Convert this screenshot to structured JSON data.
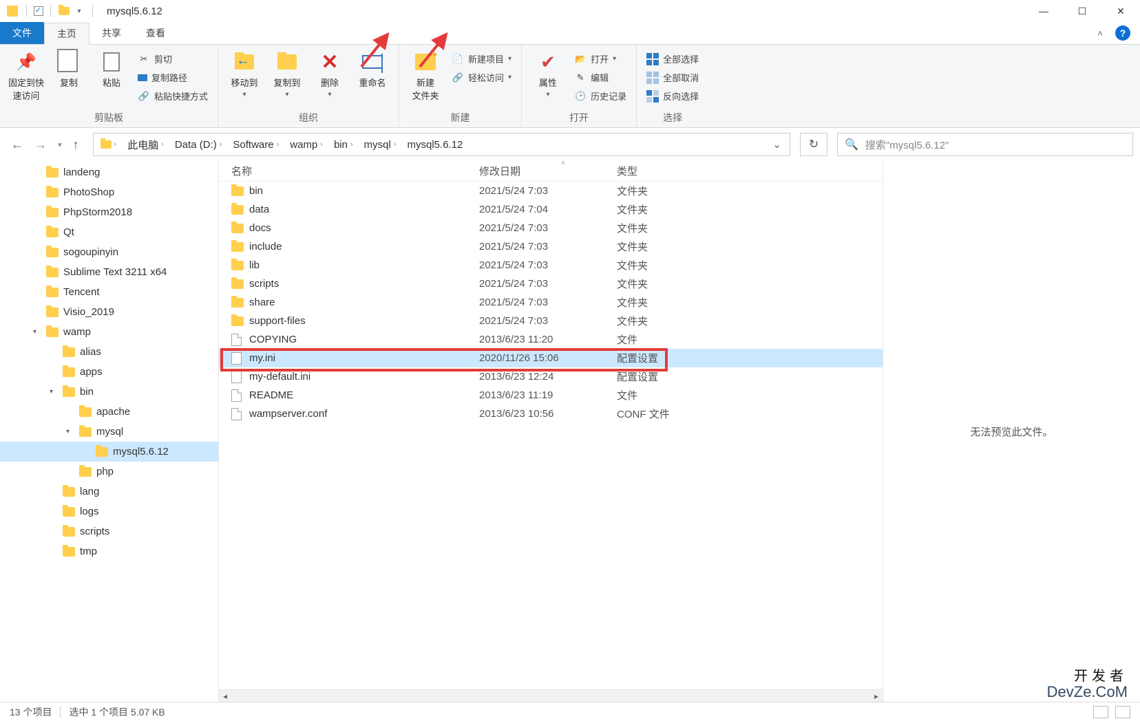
{
  "title": "mysql5.6.12",
  "tabs": {
    "file": "文件",
    "home": "主页",
    "share": "共享",
    "view": "查看"
  },
  "ribbon": {
    "clipboard": {
      "pin": "固定到快\n速访问",
      "copy": "复制",
      "paste": "粘贴",
      "cut": "剪切",
      "copypath": "复制路径",
      "paste_shortcut": "粘贴快捷方式",
      "label": "剪贴板"
    },
    "organize": {
      "move_to": "移动到",
      "copy_to": "复制到",
      "delete": "删除",
      "rename": "重命名",
      "label": "组织"
    },
    "new": {
      "new_folder": "新建\n文件夹",
      "new_item": "新建项目",
      "easy_access": "轻松访问",
      "label": "新建"
    },
    "open": {
      "properties": "属性",
      "open": "打开",
      "edit": "编辑",
      "history": "历史记录",
      "label": "打开"
    },
    "select": {
      "select_all": "全部选择",
      "select_none": "全部取消",
      "invert": "反向选择",
      "label": "选择"
    }
  },
  "breadcrumb": [
    "此电脑",
    "Data (D:)",
    "Software",
    "wamp",
    "bin",
    "mysql",
    "mysql5.6.12"
  ],
  "search_placeholder": "搜索\"mysql5.6.12\"",
  "sidebar": [
    {
      "name": "landeng",
      "depth": 1,
      "exp": ""
    },
    {
      "name": "PhotoShop",
      "depth": 1,
      "exp": ""
    },
    {
      "name": "PhpStorm2018",
      "depth": 1,
      "exp": ""
    },
    {
      "name": "Qt",
      "depth": 1,
      "exp": ""
    },
    {
      "name": "sogoupinyin",
      "depth": 1,
      "exp": ""
    },
    {
      "name": "Sublime Text 3211 x64",
      "depth": 1,
      "exp": ""
    },
    {
      "name": "Tencent",
      "depth": 1,
      "exp": ""
    },
    {
      "name": "Visio_2019",
      "depth": 1,
      "exp": ""
    },
    {
      "name": "wamp",
      "depth": 1,
      "exp": "▾"
    },
    {
      "name": "alias",
      "depth": 2,
      "exp": ""
    },
    {
      "name": "apps",
      "depth": 2,
      "exp": ""
    },
    {
      "name": "bin",
      "depth": 2,
      "exp": "▾"
    },
    {
      "name": "apache",
      "depth": 3,
      "exp": ""
    },
    {
      "name": "mysql",
      "depth": 3,
      "exp": "▾"
    },
    {
      "name": "mysql5.6.12",
      "depth": 4,
      "exp": "",
      "selected": true
    },
    {
      "name": "php",
      "depth": 3,
      "exp": ""
    },
    {
      "name": "lang",
      "depth": 2,
      "exp": ""
    },
    {
      "name": "logs",
      "depth": 2,
      "exp": ""
    },
    {
      "name": "scripts",
      "depth": 2,
      "exp": ""
    },
    {
      "name": "tmp",
      "depth": 2,
      "exp": ""
    }
  ],
  "columns": {
    "name": "名称",
    "date": "修改日期",
    "type": "类型"
  },
  "files": [
    {
      "name": "bin",
      "date": "2021/5/24 7:03",
      "type": "文件夹",
      "icon": "folder"
    },
    {
      "name": "data",
      "date": "2021/5/24 7:04",
      "type": "文件夹",
      "icon": "folder"
    },
    {
      "name": "docs",
      "date": "2021/5/24 7:03",
      "type": "文件夹",
      "icon": "folder"
    },
    {
      "name": "include",
      "date": "2021/5/24 7:03",
      "type": "文件夹",
      "icon": "folder"
    },
    {
      "name": "lib",
      "date": "2021/5/24 7:03",
      "type": "文件夹",
      "icon": "folder"
    },
    {
      "name": "scripts",
      "date": "2021/5/24 7:03",
      "type": "文件夹",
      "icon": "folder"
    },
    {
      "name": "share",
      "date": "2021/5/24 7:03",
      "type": "文件夹",
      "icon": "folder"
    },
    {
      "name": "support-files",
      "date": "2021/5/24 7:03",
      "type": "文件夹",
      "icon": "folder"
    },
    {
      "name": "COPYING",
      "date": "2013/6/23 11:20",
      "type": "文件",
      "icon": "file"
    },
    {
      "name": "my.ini",
      "date": "2020/11/26 15:06",
      "type": "配置设置",
      "icon": "ini",
      "selected": true
    },
    {
      "name": "my-default.ini",
      "date": "2013/6/23 12:24",
      "type": "配置设置",
      "icon": "ini"
    },
    {
      "name": "README",
      "date": "2013/6/23 11:19",
      "type": "文件",
      "icon": "file"
    },
    {
      "name": "wampserver.conf",
      "date": "2013/6/23 10:56",
      "type": "CONF 文件",
      "icon": "file"
    }
  ],
  "preview_text": "无法预览此文件。",
  "status": {
    "items": "13 个项目",
    "selected": "选中 1 个项目 5.07 KB"
  },
  "watermark": {
    "cn": "开发者",
    "en": "DevZe.CoM"
  }
}
